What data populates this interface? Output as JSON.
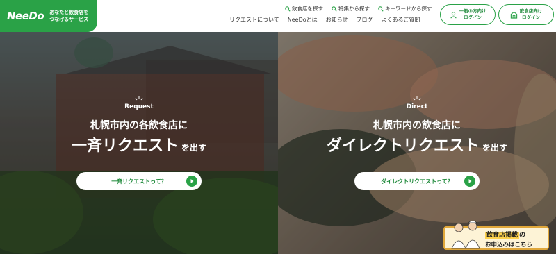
{
  "header": {
    "logo": "NeeDo",
    "tagline_line1": "あなたと飲食店を",
    "tagline_line2": "つなげるサービス",
    "util_nav": [
      {
        "label": "飲食店を探す",
        "icon": "search-icon"
      },
      {
        "label": "特集から探す",
        "icon": "search-icon"
      },
      {
        "label": "キーワードから探す",
        "icon": "search-icon"
      }
    ],
    "main_nav": [
      "リクエストについて",
      "NeeDoとは",
      "お知らせ",
      "ブログ",
      "よくあるご質問"
    ],
    "login_general": {
      "line1": "一般の方向け",
      "line2": "ログイン",
      "icon": "user-icon"
    },
    "login_shop": {
      "line1": "飲食店向け",
      "line2": "ログイン",
      "icon": "shop-icon"
    }
  },
  "hero": {
    "left": {
      "label": "Request",
      "sub": "札幌市内の各飲食店に",
      "main": "一斉リクエスト",
      "suffix": "を出す",
      "cta": "一斉リクエストって？"
    },
    "right": {
      "label": "Direct",
      "sub": "札幌市内の飲食店に",
      "main": "ダイレクトリクエスト",
      "suffix": "を出す",
      "cta": "ダイレクトリクエストって？"
    }
  },
  "banner": {
    "highlight": "飲食店掲載",
    "line1_suffix": "の",
    "line2": "お申込みはこちら"
  },
  "colors": {
    "brand_green": "#2aa247",
    "banner_border": "#e0a73a"
  }
}
